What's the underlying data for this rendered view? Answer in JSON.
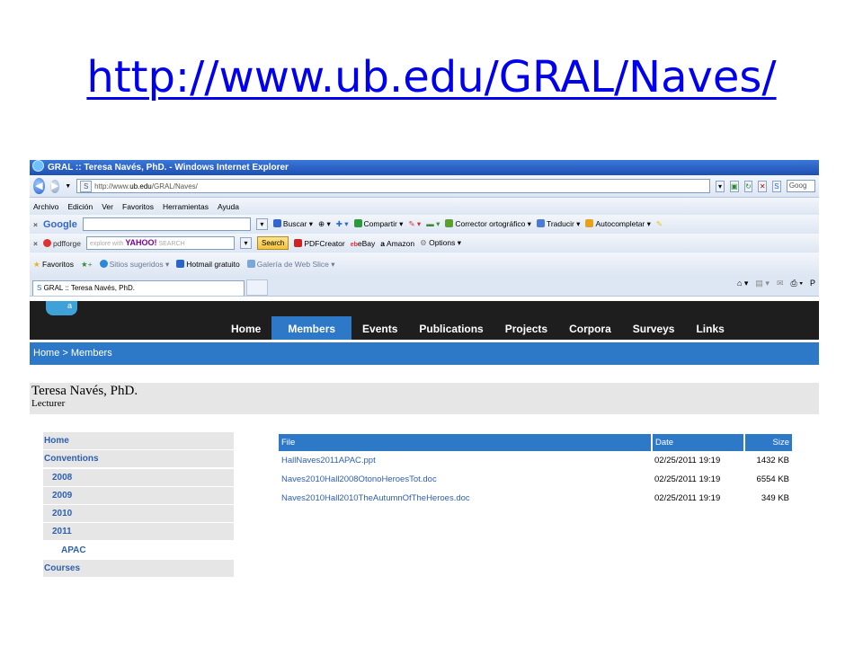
{
  "slide_title": "http://www.ub.edu/GRAL/Naves/",
  "window": {
    "title": "GRAL :: Teresa Navés, PhD. - Windows Internet Explorer"
  },
  "address_bar": {
    "url_prefix": "http://www.",
    "url_domain": "ub.edu",
    "url_path": "/GRAL/Naves/",
    "search_placeholder": "Goog"
  },
  "menubar": [
    "Archivo",
    "Edición",
    "Ver",
    "Favoritos",
    "Herramientas",
    "Ayuda"
  ],
  "google_toolbar": {
    "logo": "Google",
    "buscar": "Buscar",
    "compartir": "Compartir",
    "corrector": "Corrector ortográfico",
    "traducir": "Traducir",
    "autocompletar": "Autocompletar"
  },
  "pdfforge_toolbar": {
    "logo": "pdfforge",
    "search_hint": "explore with",
    "search_brand": "YAHOO!",
    "search_hint_suffix": "SEARCH",
    "search_button": "Search",
    "pdfcreator": "PDFCreator",
    "ebay": "eBay",
    "amazon": "Amazon",
    "options": "Options"
  },
  "favorites_bar": {
    "favoritos": "Favoritos",
    "sitios": "Sitios sugeridos",
    "hotmail": "Hotmail gratuito",
    "galeria": "Galería de Web Slice"
  },
  "tab": {
    "label": "GRAL :: Teresa Navés, PhD."
  },
  "cmd_letter": "P",
  "site_nav": {
    "logo_letter": "a",
    "items": [
      {
        "label": "Home",
        "active": false
      },
      {
        "label": "Members",
        "active": true
      },
      {
        "label": "Events",
        "active": false
      },
      {
        "label": "Publications",
        "active": false
      },
      {
        "label": "Projects",
        "active": false
      },
      {
        "label": "Corpora",
        "active": false
      },
      {
        "label": "Surveys",
        "active": false
      },
      {
        "label": "Links",
        "active": false
      }
    ]
  },
  "breadcrumb": "Home > Members",
  "person": {
    "name": "Teresa Navés, PhD.",
    "role": "Lecturer"
  },
  "sidebar": [
    {
      "label": "Home",
      "level": 1
    },
    {
      "label": "Conventions",
      "level": 1
    },
    {
      "label": "2008",
      "level": 2
    },
    {
      "label": "2009",
      "level": 2
    },
    {
      "label": "2010",
      "level": 2
    },
    {
      "label": "2011",
      "level": 2
    },
    {
      "label": "APAC",
      "level": 3
    },
    {
      "label": "Courses",
      "level": 1
    }
  ],
  "files_table": {
    "headers": {
      "file": "File",
      "date": "Date",
      "size": "Size"
    },
    "rows": [
      {
        "file": "HallNaves2011APAC.ppt",
        "date": "02/25/2011 19:19",
        "size": "1432 KB"
      },
      {
        "file": "Naves2010Hall2008OtonoHeroesTot.doc",
        "date": "02/25/2011 19:19",
        "size": "6554 KB"
      },
      {
        "file": "Naves2010Hall2010TheAutumnOfTheHeroes.doc",
        "date": "02/25/2011 19:19",
        "size": "349 KB"
      }
    ]
  }
}
